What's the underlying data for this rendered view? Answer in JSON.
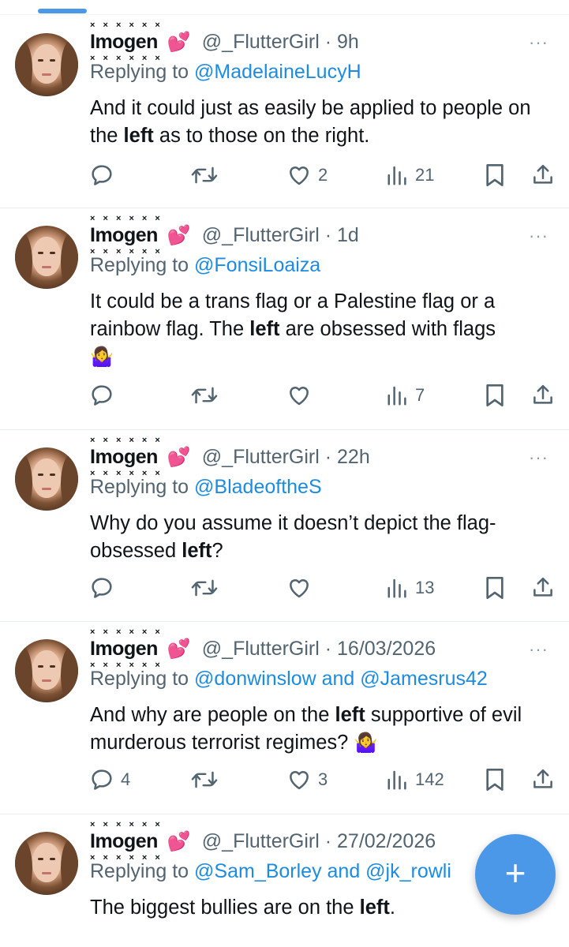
{
  "tweets": [
    {
      "display_name": "Imogen",
      "name_marks": "× × × × × ×",
      "heart": "💕",
      "handle_time": "@_FlutterGirl · 9h",
      "replying_prefix": "Replying to ",
      "replying_to": "@MadelaineLucyH",
      "text_before": "And it could just as easily be applied to people on the ",
      "text_bold": "left",
      "text_after": " as to those on the right.",
      "emoji": "",
      "reply_count": "",
      "retweet_count": "",
      "like_count": "2",
      "view_count": "21"
    },
    {
      "display_name": "Imogen",
      "name_marks": "× × × × × ×",
      "heart": "💕",
      "handle_time": "@_FlutterGirl · 1d",
      "replying_prefix": "Replying to ",
      "replying_to": "@FonsiLoaiza",
      "text_before": "It could be a trans flag or a Palestine flag or a rainbow flag. The ",
      "text_bold": "left",
      "text_after": " are obsessed with flags",
      "emoji": "🤷‍♀️",
      "reply_count": "",
      "retweet_count": "",
      "like_count": "",
      "view_count": "7"
    },
    {
      "display_name": "Imogen",
      "name_marks": "× × × × × ×",
      "heart": "💕",
      "handle_time": "@_FlutterGirl · 22h",
      "replying_prefix": "Replying to ",
      "replying_to": "@BladeoftheS",
      "text_before": "Why do you assume it doesn’t depict the flag-obsessed ",
      "text_bold": "left",
      "text_after": "?",
      "emoji": "",
      "reply_count": "",
      "retweet_count": "",
      "like_count": "",
      "view_count": "13"
    },
    {
      "display_name": "Imogen",
      "name_marks": "× × × × × ×",
      "heart": "💕",
      "handle_time": "@_FlutterGirl · 16/03/2026",
      "replying_prefix": "Replying to ",
      "replying_to": "@donwinslow and @Jamesrus42",
      "text_before": "And why are people on the ",
      "text_bold": "left",
      "text_after": " supportive of evil murderous terrorist regimes? ",
      "emoji": "🤷‍♀️",
      "reply_count": "4",
      "retweet_count": "",
      "like_count": "3",
      "view_count": "142"
    },
    {
      "display_name": "Imogen",
      "name_marks": "× × × × × ×",
      "heart": "💕",
      "handle_time": "@_FlutterGirl · 27/02/2026",
      "replying_prefix": "Replying to ",
      "replying_to": "@Sam_Borley and @jk_rowli",
      "text_before": "The biggest bullies are on the ",
      "text_bold": "left",
      "text_after": ".",
      "emoji": "",
      "reply_count": "",
      "retweet_count": "",
      "like_count": "",
      "view_count": ""
    }
  ],
  "more_menu": "···",
  "fab_label": "+",
  "icons": {
    "reply": "reply-icon",
    "retweet": "retweet-icon",
    "like": "heart-icon",
    "views": "views-icon",
    "bookmark": "bookmark-icon",
    "share": "share-icon"
  },
  "colors": {
    "accent": "#1d8ce0",
    "fab": "#4b98e8",
    "secondary_text": "#536471",
    "heart_emoji": "#e84aa5"
  }
}
